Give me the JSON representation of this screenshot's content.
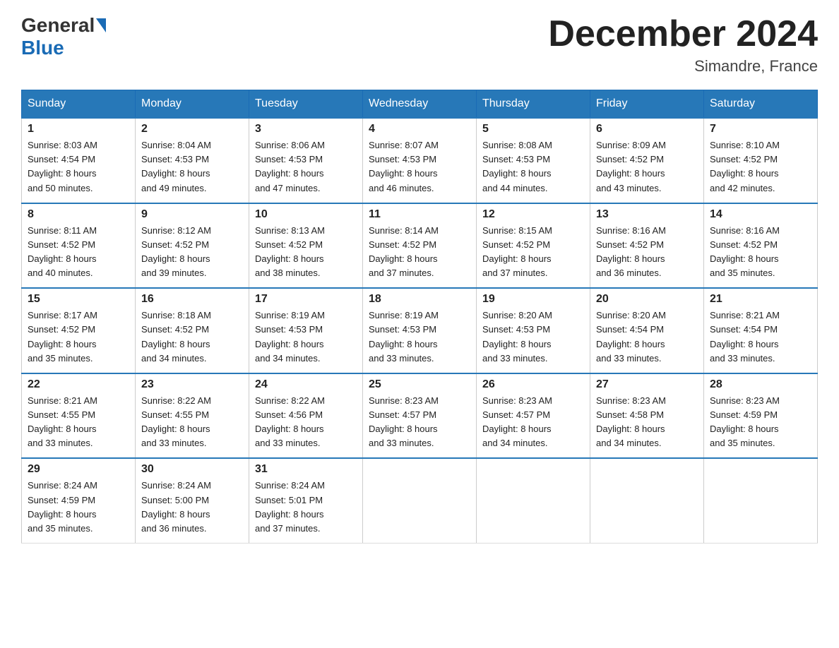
{
  "header": {
    "logo_general": "General",
    "logo_blue": "Blue",
    "month_title": "December 2024",
    "location": "Simandre, France"
  },
  "days_of_week": [
    "Sunday",
    "Monday",
    "Tuesday",
    "Wednesday",
    "Thursday",
    "Friday",
    "Saturday"
  ],
  "weeks": [
    [
      {
        "day": "1",
        "sunrise": "8:03 AM",
        "sunset": "4:54 PM",
        "daylight": "8 hours and 50 minutes."
      },
      {
        "day": "2",
        "sunrise": "8:04 AM",
        "sunset": "4:53 PM",
        "daylight": "8 hours and 49 minutes."
      },
      {
        "day": "3",
        "sunrise": "8:06 AM",
        "sunset": "4:53 PM",
        "daylight": "8 hours and 47 minutes."
      },
      {
        "day": "4",
        "sunrise": "8:07 AM",
        "sunset": "4:53 PM",
        "daylight": "8 hours and 46 minutes."
      },
      {
        "day": "5",
        "sunrise": "8:08 AM",
        "sunset": "4:53 PM",
        "daylight": "8 hours and 44 minutes."
      },
      {
        "day": "6",
        "sunrise": "8:09 AM",
        "sunset": "4:52 PM",
        "daylight": "8 hours and 43 minutes."
      },
      {
        "day": "7",
        "sunrise": "8:10 AM",
        "sunset": "4:52 PM",
        "daylight": "8 hours and 42 minutes."
      }
    ],
    [
      {
        "day": "8",
        "sunrise": "8:11 AM",
        "sunset": "4:52 PM",
        "daylight": "8 hours and 40 minutes."
      },
      {
        "day": "9",
        "sunrise": "8:12 AM",
        "sunset": "4:52 PM",
        "daylight": "8 hours and 39 minutes."
      },
      {
        "day": "10",
        "sunrise": "8:13 AM",
        "sunset": "4:52 PM",
        "daylight": "8 hours and 38 minutes."
      },
      {
        "day": "11",
        "sunrise": "8:14 AM",
        "sunset": "4:52 PM",
        "daylight": "8 hours and 37 minutes."
      },
      {
        "day": "12",
        "sunrise": "8:15 AM",
        "sunset": "4:52 PM",
        "daylight": "8 hours and 37 minutes."
      },
      {
        "day": "13",
        "sunrise": "8:16 AM",
        "sunset": "4:52 PM",
        "daylight": "8 hours and 36 minutes."
      },
      {
        "day": "14",
        "sunrise": "8:16 AM",
        "sunset": "4:52 PM",
        "daylight": "8 hours and 35 minutes."
      }
    ],
    [
      {
        "day": "15",
        "sunrise": "8:17 AM",
        "sunset": "4:52 PM",
        "daylight": "8 hours and 35 minutes."
      },
      {
        "day": "16",
        "sunrise": "8:18 AM",
        "sunset": "4:52 PM",
        "daylight": "8 hours and 34 minutes."
      },
      {
        "day": "17",
        "sunrise": "8:19 AM",
        "sunset": "4:53 PM",
        "daylight": "8 hours and 34 minutes."
      },
      {
        "day": "18",
        "sunrise": "8:19 AM",
        "sunset": "4:53 PM",
        "daylight": "8 hours and 33 minutes."
      },
      {
        "day": "19",
        "sunrise": "8:20 AM",
        "sunset": "4:53 PM",
        "daylight": "8 hours and 33 minutes."
      },
      {
        "day": "20",
        "sunrise": "8:20 AM",
        "sunset": "4:54 PM",
        "daylight": "8 hours and 33 minutes."
      },
      {
        "day": "21",
        "sunrise": "8:21 AM",
        "sunset": "4:54 PM",
        "daylight": "8 hours and 33 minutes."
      }
    ],
    [
      {
        "day": "22",
        "sunrise": "8:21 AM",
        "sunset": "4:55 PM",
        "daylight": "8 hours and 33 minutes."
      },
      {
        "day": "23",
        "sunrise": "8:22 AM",
        "sunset": "4:55 PM",
        "daylight": "8 hours and 33 minutes."
      },
      {
        "day": "24",
        "sunrise": "8:22 AM",
        "sunset": "4:56 PM",
        "daylight": "8 hours and 33 minutes."
      },
      {
        "day": "25",
        "sunrise": "8:23 AM",
        "sunset": "4:57 PM",
        "daylight": "8 hours and 33 minutes."
      },
      {
        "day": "26",
        "sunrise": "8:23 AM",
        "sunset": "4:57 PM",
        "daylight": "8 hours and 34 minutes."
      },
      {
        "day": "27",
        "sunrise": "8:23 AM",
        "sunset": "4:58 PM",
        "daylight": "8 hours and 34 minutes."
      },
      {
        "day": "28",
        "sunrise": "8:23 AM",
        "sunset": "4:59 PM",
        "daylight": "8 hours and 35 minutes."
      }
    ],
    [
      {
        "day": "29",
        "sunrise": "8:24 AM",
        "sunset": "4:59 PM",
        "daylight": "8 hours and 35 minutes."
      },
      {
        "day": "30",
        "sunrise": "8:24 AM",
        "sunset": "5:00 PM",
        "daylight": "8 hours and 36 minutes."
      },
      {
        "day": "31",
        "sunrise": "8:24 AM",
        "sunset": "5:01 PM",
        "daylight": "8 hours and 37 minutes."
      },
      null,
      null,
      null,
      null
    ]
  ],
  "labels": {
    "sunrise": "Sunrise: ",
    "sunset": "Sunset: ",
    "daylight": "Daylight: "
  }
}
